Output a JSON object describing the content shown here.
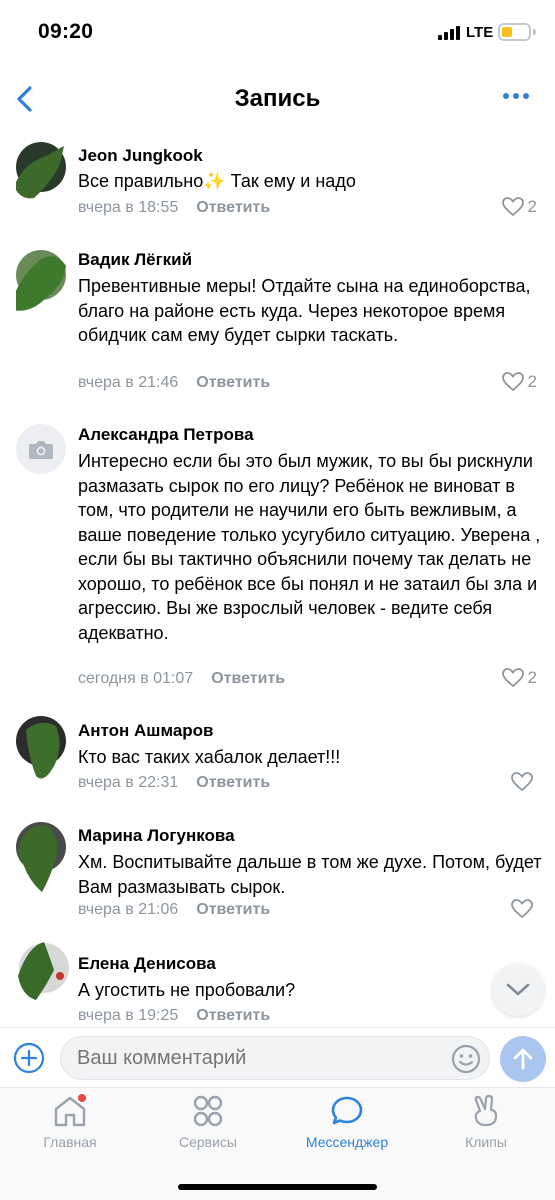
{
  "status_bar": {
    "time": "09:20",
    "network": "LTE",
    "accent_battery": "#f4c01c"
  },
  "header": {
    "title": "Запись",
    "back_icon": "chevron-left-icon",
    "more_icon": "more-horizontal-icon",
    "accent": "#2f7ed8"
  },
  "comments": [
    {
      "author": "Jeon Jungkook",
      "text": "Все правильно✨ Так ему и надо",
      "time": "вчера в 18:55",
      "reply": "Ответить",
      "likes": "2"
    },
    {
      "author": "Вадик Лёгкий",
      "text": "Превентивные меры! Отдайте сына на единоборства, благо на районе есть куда. Через некоторое время обидчик сам ему будет сырки таскать.",
      "time": "вчера в 21:46",
      "reply": "Ответить",
      "likes": "2"
    },
    {
      "author": "Александра Петрова",
      "text": "Интересно если бы это был мужик, то вы бы рискнули размазать сырок по его лицу? Ребёнок не виноват в том, что родители не научили его быть вежливым, а ваше поведение только усугубило ситуацию. Уверена , если бы вы тактично объяснили почему так делать не хорошо, то ребёнок все бы понял и не затаил бы зла и агрессию. Вы же взрослый человек - ведите себя адекватно.",
      "time": "сегодня в 01:07",
      "reply": "Ответить",
      "likes": "2"
    },
    {
      "author": "Антон Ашмаров",
      "text": "Кто вас таких хабалок делает!!!",
      "time": "вчера в 22:31",
      "reply": "Ответить",
      "likes": ""
    },
    {
      "author": "Марина Логункова",
      "text": "Хм. Воспитывайте дальше в том же духе. Потом, будет Вам размазывать сырок.",
      "time": "вчера в 21:06",
      "reply": "Ответить",
      "likes": ""
    },
    {
      "author": "Елена Денисова",
      "text": "А угостить не пробовали?",
      "time": "вчера в 19:25",
      "reply": "Ответить",
      "likes": ""
    }
  ],
  "composer": {
    "placeholder": "Ваш комментарий",
    "add_icon": "plus-circle-icon",
    "emoji_icon": "smile-icon",
    "send_icon": "arrow-up-icon"
  },
  "tabs": [
    {
      "label": "Главная",
      "icon": "home-icon",
      "active": false
    },
    {
      "label": "Сервисы",
      "icon": "services-grid-icon",
      "active": false
    },
    {
      "label": "Мессенджер",
      "icon": "message-bubble-icon",
      "active": true
    },
    {
      "label": "Клипы",
      "icon": "clips-icon",
      "active": false
    }
  ],
  "colors": {
    "link_blue": "#2d81e0",
    "meta_gray": "#8d959f",
    "notification_dot": "#e64646"
  }
}
